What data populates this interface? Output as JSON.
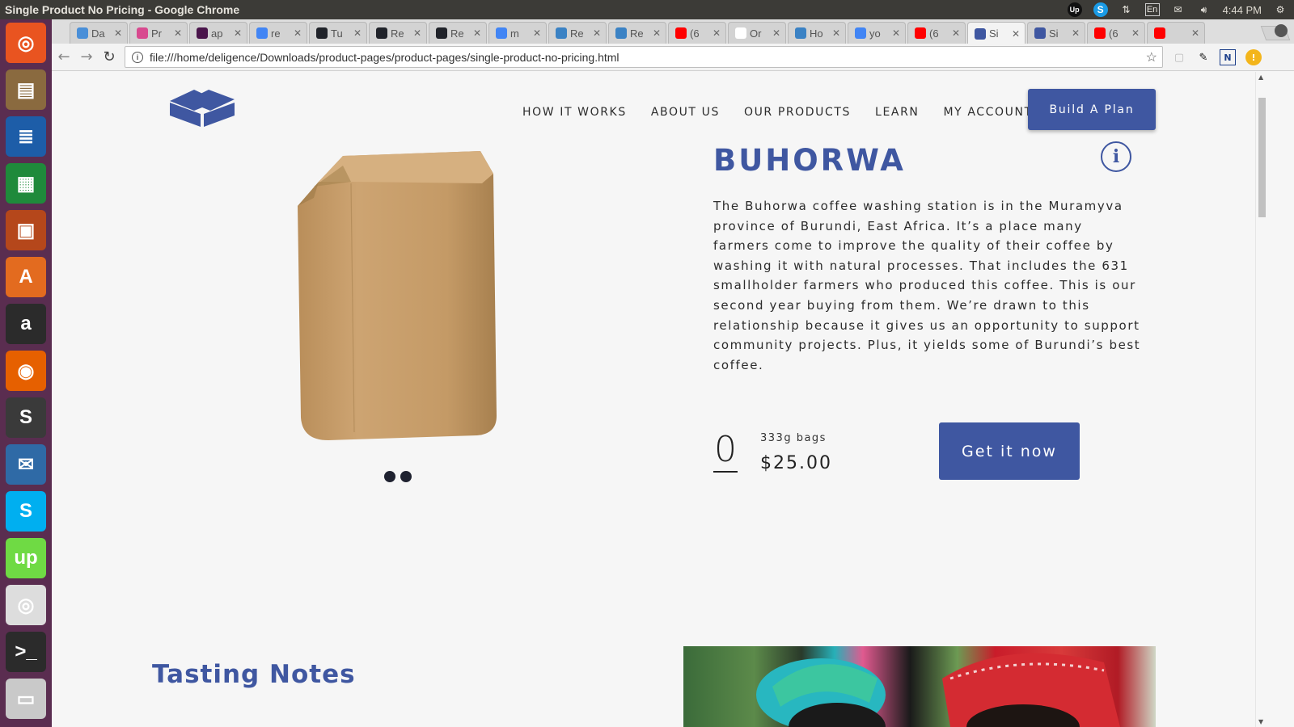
{
  "window": {
    "title": "Single Product No Pricing - Google Chrome"
  },
  "system_tray": {
    "language": "En",
    "time": "4:44 PM"
  },
  "launcher": [
    {
      "name": "ubuntu-dash",
      "color": "#e95420",
      "glyph": "◎"
    },
    {
      "name": "files",
      "color": "#8a6a3f",
      "glyph": "▤"
    },
    {
      "name": "writer",
      "color": "#1d5da8",
      "glyph": "≣"
    },
    {
      "name": "calc",
      "color": "#1f8a3b",
      "glyph": "▦"
    },
    {
      "name": "impress",
      "color": "#b5471b",
      "glyph": "▣"
    },
    {
      "name": "software-center",
      "color": "#e36b1f",
      "glyph": "A"
    },
    {
      "name": "amazon",
      "color": "#2b2b2b",
      "glyph": "a"
    },
    {
      "name": "firefox",
      "color": "#e66000",
      "glyph": "◉"
    },
    {
      "name": "sublime",
      "color": "#3a3a3a",
      "glyph": "S"
    },
    {
      "name": "thunderbird",
      "color": "#2f6aa6",
      "glyph": "✉"
    },
    {
      "name": "skype",
      "color": "#00aff0",
      "glyph": "S"
    },
    {
      "name": "upwork",
      "color": "#6fda44",
      "glyph": "up"
    },
    {
      "name": "chrome",
      "color": "#dddddd",
      "glyph": "◎"
    },
    {
      "name": "terminal",
      "color": "#2b2b2b",
      "glyph": ">_"
    },
    {
      "name": "scanner",
      "color": "#c9c9c9",
      "glyph": "▭"
    }
  ],
  "tabs": [
    {
      "label": "Da",
      "fav": "#4a8fd8"
    },
    {
      "label": "Pr",
      "fav": "#d84a8f"
    },
    {
      "label": "ap",
      "fav": "#4a154b"
    },
    {
      "label": "re",
      "fav": "#4285f4"
    },
    {
      "label": "Tu",
      "fav": "#20232a"
    },
    {
      "label": "Re",
      "fav": "#20232a"
    },
    {
      "label": "Re",
      "fav": "#20232a"
    },
    {
      "label": "m",
      "fav": "#4285f4"
    },
    {
      "label": "Re",
      "fav": "#3b82c4"
    },
    {
      "label": "Re",
      "fav": "#3b82c4"
    },
    {
      "label": "(6",
      "fav": "#ff0000"
    },
    {
      "label": "Or",
      "fav": "#ffffff"
    },
    {
      "label": "Ho",
      "fav": "#3b82c4"
    },
    {
      "label": "yo",
      "fav": "#4285f4"
    },
    {
      "label": "(6",
      "fav": "#ff0000"
    },
    {
      "label": "Si",
      "fav": "#3f57a1",
      "active": true
    },
    {
      "label": "Si",
      "fav": "#3f57a1"
    },
    {
      "label": "(6",
      "fav": "#ff0000"
    },
    {
      "label": "",
      "fav": "#ff0000"
    }
  ],
  "omnibox": {
    "url": "file:///home/deligence/Downloads/product-pages/product-pages/single-product-no-pricing.html"
  },
  "site": {
    "nav": [
      "HOW IT WORKS",
      "ABOUT US",
      "OUR PRODUCTS",
      "LEARN",
      "MY ACCOUNT"
    ],
    "build_plan": "Build A Plan",
    "accent": "#3f57a1"
  },
  "product": {
    "name": "BUHORWA",
    "description": "The Buhorwa coffee washing station is in the Muramyva province of Burundi, East Africa. It’s a place many farmers come to improve the quality of their coffee by washing it with natural processes. That includes the 631 smallholder farmers who produced this coffee. This is our second year buying from them. We’re drawn to this relationship because it gives us an opportunity to support community projects. Plus, it yields some of Burundi’s best coffee.",
    "quantity": "0",
    "bag_size": "333g bags",
    "price": "$25.00",
    "cta": "Get it now"
  },
  "tasting": {
    "title": "Tasting Notes"
  }
}
